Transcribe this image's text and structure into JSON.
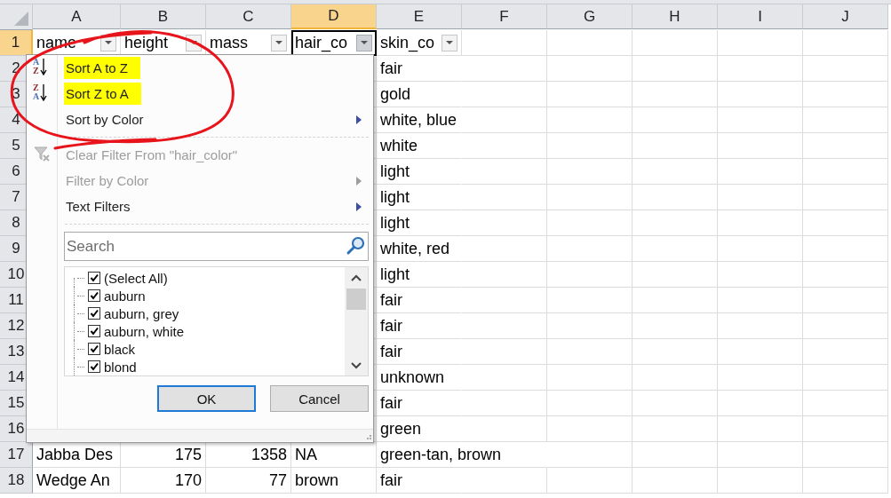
{
  "columns": [
    {
      "label": "A",
      "selected": false
    },
    {
      "label": "B",
      "selected": false
    },
    {
      "label": "C",
      "selected": false
    },
    {
      "label": "D",
      "selected": true
    },
    {
      "label": "E",
      "selected": false
    },
    {
      "label": "F",
      "selected": false
    },
    {
      "label": "G",
      "selected": false
    },
    {
      "label": "H",
      "selected": false
    },
    {
      "label": "I",
      "selected": false
    },
    {
      "label": "J",
      "selected": false
    }
  ],
  "rows": [
    {
      "number": "1",
      "selected": true,
      "filters": true,
      "cells": [
        "name",
        "height",
        "mass",
        "hair_co",
        "skin_co"
      ]
    },
    {
      "number": "2",
      "selected": false,
      "filters": false,
      "cells": [
        null,
        null,
        null,
        null,
        "fair"
      ]
    },
    {
      "number": "3",
      "selected": false,
      "filters": false,
      "cells": [
        null,
        null,
        null,
        null,
        "gold"
      ]
    },
    {
      "number": "4",
      "selected": false,
      "filters": false,
      "cells": [
        null,
        null,
        null,
        null,
        "white, blue"
      ]
    },
    {
      "number": "5",
      "selected": false,
      "filters": false,
      "cells": [
        null,
        null,
        null,
        null,
        "white"
      ]
    },
    {
      "number": "6",
      "selected": false,
      "filters": false,
      "cells": [
        null,
        null,
        null,
        null,
        "light"
      ]
    },
    {
      "number": "7",
      "selected": false,
      "filters": false,
      "cells": [
        null,
        null,
        null,
        null,
        "light"
      ]
    },
    {
      "number": "8",
      "selected": false,
      "filters": false,
      "cells": [
        null,
        null,
        null,
        null,
        "light"
      ]
    },
    {
      "number": "9",
      "selected": false,
      "filters": false,
      "cells": [
        null,
        null,
        null,
        null,
        "white, red"
      ]
    },
    {
      "number": "10",
      "selected": false,
      "filters": false,
      "cells": [
        null,
        null,
        null,
        null,
        "light"
      ]
    },
    {
      "number": "11",
      "selected": false,
      "filters": false,
      "cells": [
        null,
        null,
        null,
        null,
        "fair"
      ]
    },
    {
      "number": "12",
      "selected": false,
      "filters": false,
      "cells": [
        null,
        null,
        null,
        null,
        "fair"
      ]
    },
    {
      "number": "13",
      "selected": false,
      "filters": false,
      "cells": [
        null,
        null,
        null,
        null,
        "fair"
      ]
    },
    {
      "number": "14",
      "selected": false,
      "filters": false,
      "cells": [
        null,
        null,
        null,
        null,
        "unknown"
      ]
    },
    {
      "number": "15",
      "selected": false,
      "filters": false,
      "cells": [
        null,
        null,
        null,
        null,
        "fair"
      ]
    },
    {
      "number": "16",
      "selected": false,
      "filters": false,
      "cells": [
        null,
        null,
        null,
        null,
        "green"
      ]
    },
    {
      "number": "17",
      "selected": false,
      "filters": false,
      "cells": [
        "Jabba Des",
        "175",
        "1358",
        "NA",
        "green-tan, brown"
      ]
    },
    {
      "number": "18",
      "selected": false,
      "filters": false,
      "cells": [
        "Wedge An",
        "170",
        "77",
        "brown",
        "fair"
      ]
    }
  ],
  "filter_menu": {
    "items": [
      {
        "kind": "sort",
        "label": "Sort A to Z",
        "icon_letters": [
          "A",
          "Z"
        ],
        "submenu": false,
        "disabled": false,
        "highlighted": true
      },
      {
        "kind": "sort",
        "label": "Sort Z to A",
        "icon_letters": [
          "Z",
          "A"
        ],
        "submenu": false,
        "disabled": false,
        "highlighted": true
      },
      {
        "kind": "plain",
        "label": "Sort by Color",
        "submenu": true,
        "disabled": false,
        "highlighted": false
      },
      {
        "kind": "separator"
      },
      {
        "kind": "clear",
        "label": "Clear Filter From \"hair_color\"",
        "submenu": false,
        "disabled": true,
        "highlighted": false
      },
      {
        "kind": "plain",
        "label": "Filter by Color",
        "submenu": true,
        "disabled": true,
        "highlighted": false
      },
      {
        "kind": "plain",
        "label": "Text Filters",
        "submenu": true,
        "disabled": false,
        "highlighted": false
      },
      {
        "kind": "separator"
      }
    ],
    "search": {
      "placeholder": "Search"
    },
    "values": [
      {
        "label": "(Select All)",
        "checked": true
      },
      {
        "label": "auburn",
        "checked": true
      },
      {
        "label": "auburn, grey",
        "checked": true
      },
      {
        "label": "auburn, white",
        "checked": true
      },
      {
        "label": "black",
        "checked": true
      },
      {
        "label": "blond",
        "checked": true
      }
    ],
    "buttons": [
      {
        "label": "OK",
        "default": true
      },
      {
        "label": "Cancel",
        "default": false
      }
    ]
  }
}
